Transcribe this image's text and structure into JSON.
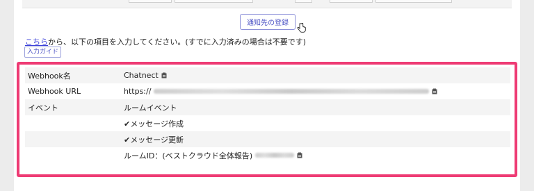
{
  "register_button": {
    "label": "通知先の登録"
  },
  "instruction": {
    "link_text": "こちら",
    "rest_text": "から、以下の項目を入力してください。(すでに入力済みの場合は不要です)"
  },
  "guide_button": {
    "label": "入力ガイド"
  },
  "table": {
    "webhook_name": {
      "label": "Webhook名",
      "value": "Chatnect"
    },
    "webhook_url": {
      "label": "Webhook URL",
      "value_prefix": "https://"
    },
    "event": {
      "label": "イベント",
      "header": "ルームイベント",
      "items": [
        "✔メッセージ作成",
        "✔メッセージ更新"
      ],
      "room_id_label": "ルームID：(ベストクラウド全体報告)"
    }
  },
  "colors": {
    "highlight": "#ee3b74",
    "accent": "#4b52c4",
    "link": "#3b40d9"
  }
}
